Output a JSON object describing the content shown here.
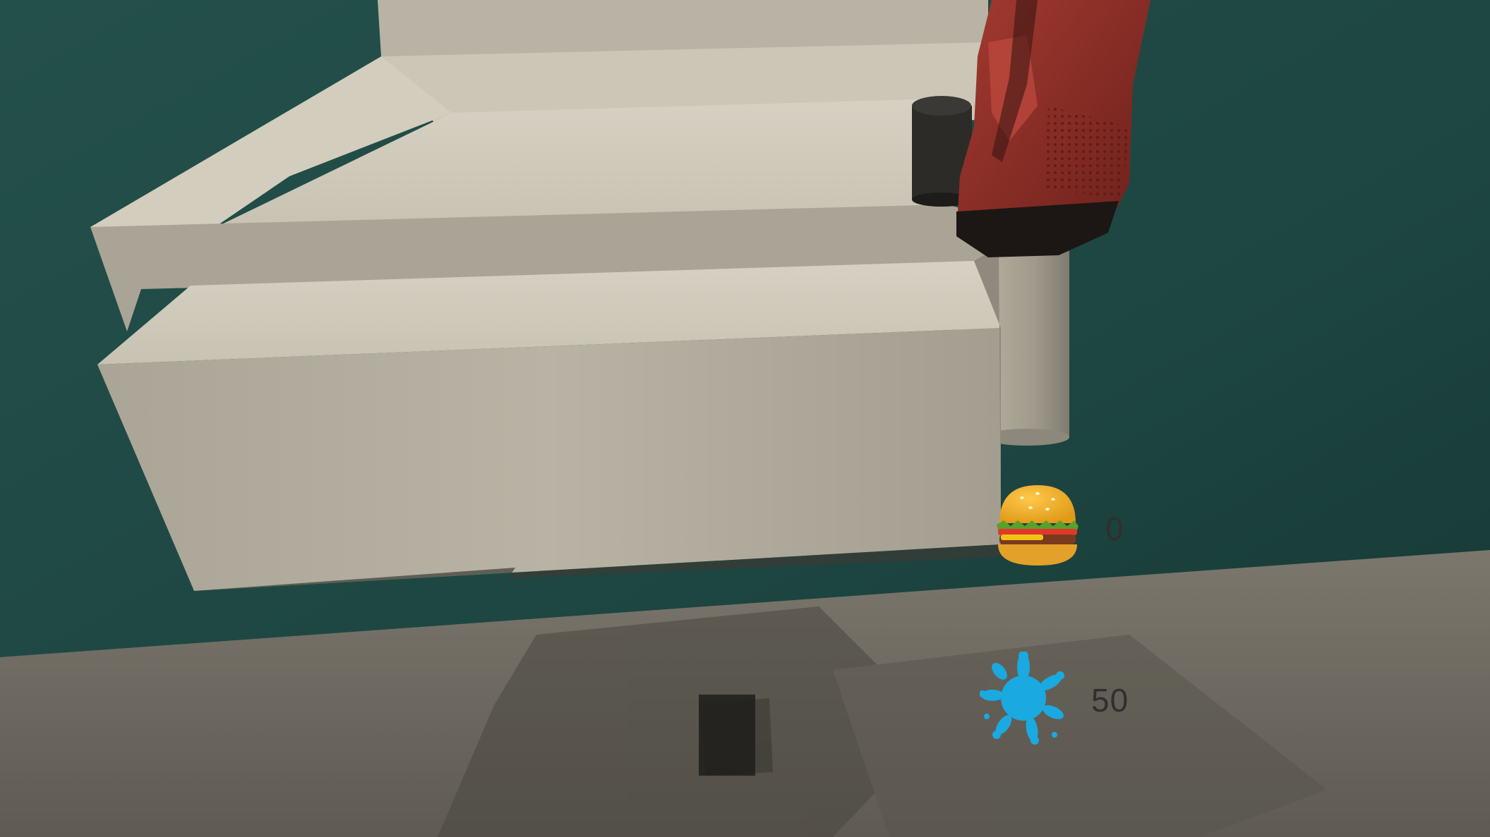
{
  "hud": {
    "food": {
      "icon": "burger-icon",
      "count": "0"
    },
    "paint": {
      "icon": "blue-paint-splat-icon",
      "count": "50",
      "color": "#1aa9e0"
    }
  },
  "scene": {
    "wall_color": "#1f4743",
    "floor_color": "#6f6b61",
    "counter_color": "#c9c4b5",
    "glove_color": "#8e2a24",
    "objects": [
      "wall",
      "floor",
      "counter",
      "cylinder-post",
      "vr-glove-hand"
    ]
  }
}
